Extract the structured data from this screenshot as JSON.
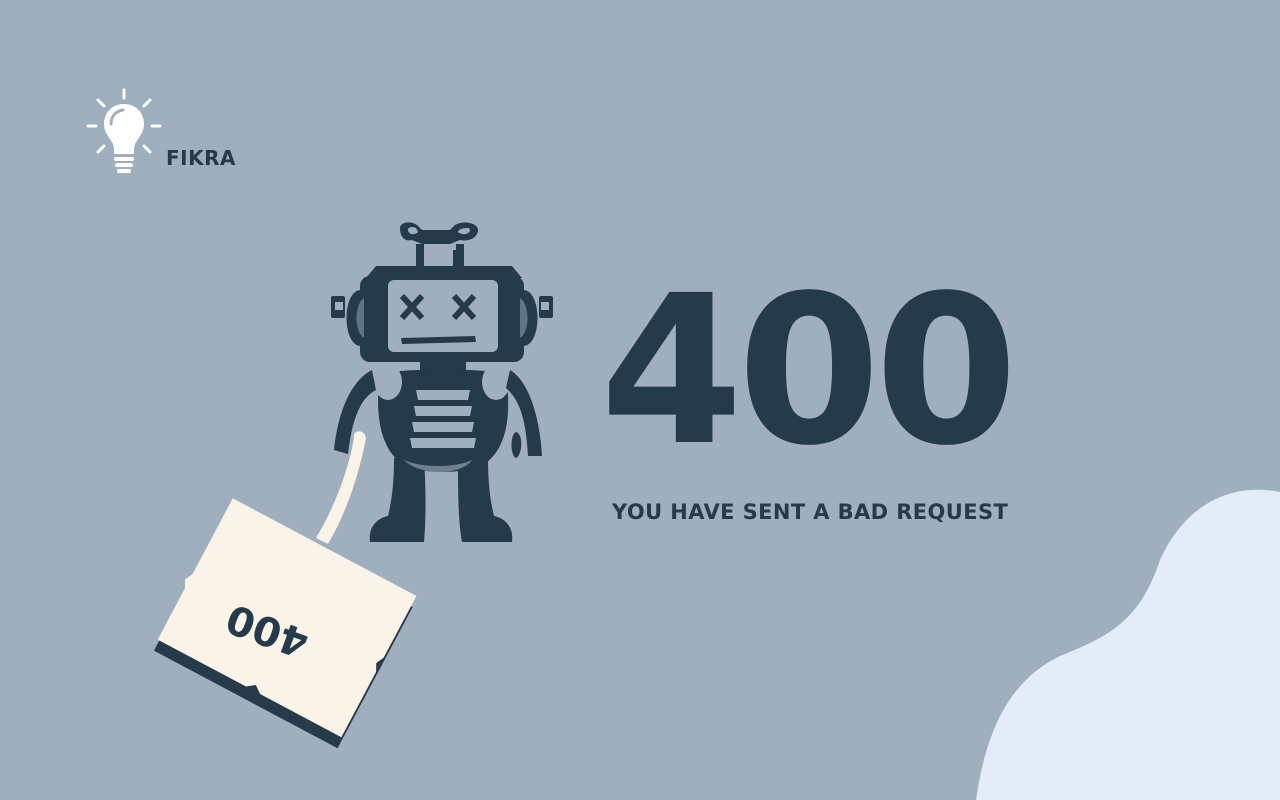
{
  "colors": {
    "background": "#a0afbd",
    "primary": "#253b4b",
    "sign": "#faf4e8",
    "blob": "#e3ecf8",
    "white": "#ffffff"
  },
  "logo": {
    "icon": "lightbulb-icon",
    "text": "FIKRA"
  },
  "illustration": {
    "robot_icon": "broken-robot-icon",
    "sign_text": "400"
  },
  "error": {
    "code": "400",
    "message": "YOU HAVE SENT A BAD REQUEST"
  }
}
